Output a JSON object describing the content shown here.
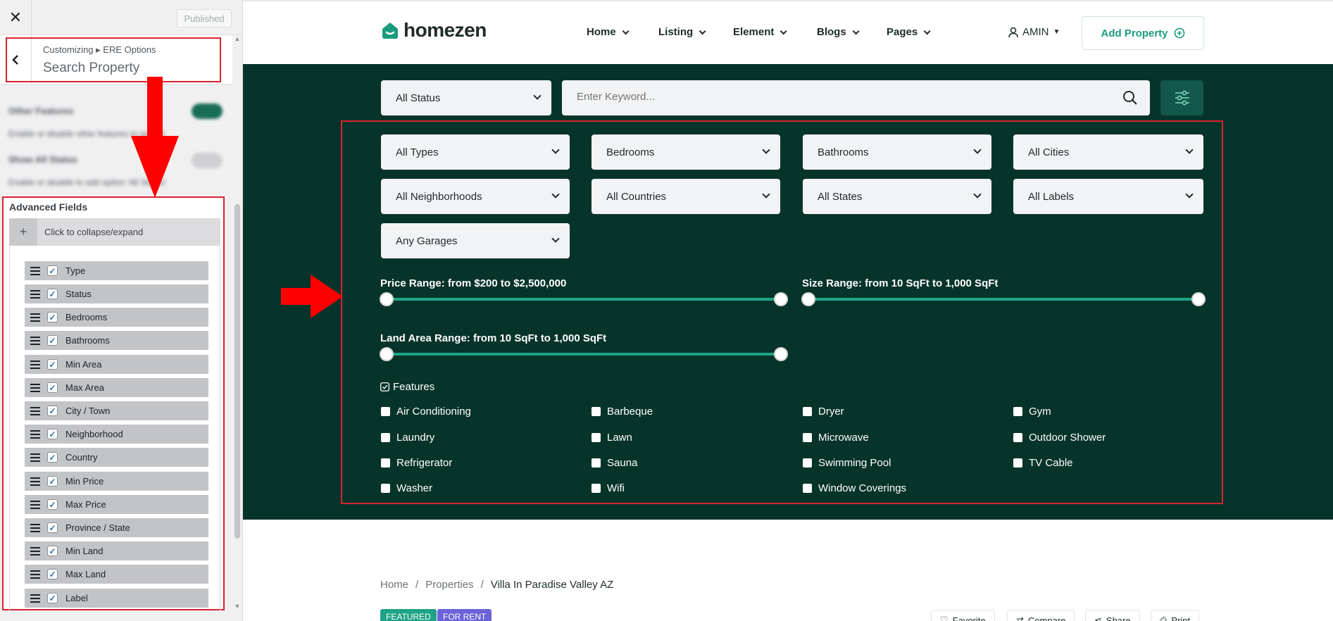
{
  "customizer": {
    "close_symbol": "✕",
    "publish_label": "Published",
    "breadcrumb": "Customizing ▸ ERE Options",
    "section_title": "Search Property",
    "blurred": {
      "other_features_title": "Other Features",
      "other_features_desc": "Enable or disable other features in search",
      "show_all_status_title": "Show All Status",
      "show_all_status_desc": "Enable or disable to add option 'All Status'"
    },
    "advanced_fields_title": "Advanced Fields",
    "collapse_label": "Click to collapse/expand",
    "fields": [
      {
        "label": "Type",
        "checked": true
      },
      {
        "label": "Status",
        "checked": true
      },
      {
        "label": "Bedrooms",
        "checked": true
      },
      {
        "label": "Bathrooms",
        "checked": true
      },
      {
        "label": "Min Area",
        "checked": true
      },
      {
        "label": "Max Area",
        "checked": true
      },
      {
        "label": "City / Town",
        "checked": true
      },
      {
        "label": "Neighborhood",
        "checked": true
      },
      {
        "label": "Country",
        "checked": true
      },
      {
        "label": "Min Price",
        "checked": true
      },
      {
        "label": "Max Price",
        "checked": true
      },
      {
        "label": "Province / State",
        "checked": true
      },
      {
        "label": "Min Land",
        "checked": true
      },
      {
        "label": "Max Land",
        "checked": true
      },
      {
        "label": "Label",
        "checked": true
      }
    ],
    "annotation_color": "#d9232d"
  },
  "site": {
    "logo": "homezen",
    "nav": [
      "Home",
      "Listing",
      "Element",
      "Blogs",
      "Pages"
    ],
    "user_label": "AMIN",
    "add_property_label": "Add Property",
    "brand_color": "#1b9b7e",
    "hero_bg": "#07342a",
    "search": {
      "status_select": "All Status",
      "keyword_placeholder": "Enter Keyword...",
      "selects": [
        "All Types",
        "Bedrooms",
        "Bathrooms",
        "All Cities",
        "All Neighborhoods",
        "All Countries",
        "All States",
        "All Labels",
        "Any Garages"
      ],
      "price_range": "Price Range: from $200 to $2,500,000",
      "size_range": "Size Range: from 10 SqFt to 1,000 SqFt",
      "land_range": "Land Area Range: from 10 SqFt to 1,000 SqFt",
      "features_title": "Features",
      "features": [
        "Air Conditioning",
        "Barbeque",
        "Dryer",
        "Gym",
        "Laundry",
        "Lawn",
        "Microwave",
        "Outdoor Shower",
        "Refrigerator",
        "Sauna",
        "Swimming Pool",
        "TV Cable",
        "Washer",
        "Wifi",
        "Window Coverings"
      ]
    },
    "breadcrumb": [
      "Home",
      "Properties",
      "Villa In Paradise Valley AZ"
    ],
    "badges": [
      {
        "label": "FEATURED",
        "color": "#1fa386"
      },
      {
        "label": "FOR RENT",
        "color": "#6c63d9"
      }
    ],
    "actions": [
      "Favorite",
      "Compare",
      "Share",
      "Print"
    ]
  }
}
